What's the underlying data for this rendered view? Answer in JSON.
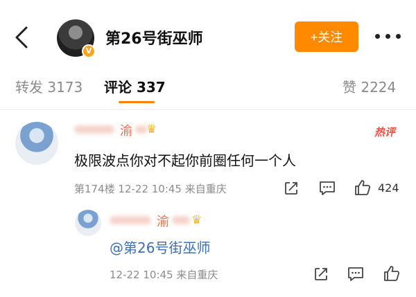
{
  "header": {
    "back_icon": "chevron-left-icon",
    "name": "第26号街巫师",
    "badge_icon": "verified-badge-icon",
    "follow_label": "+关注",
    "more_icon": "more-dots-icon",
    "accent_color": "#ff8a00"
  },
  "tabs": [
    {
      "label": "转发 3173",
      "active": false
    },
    {
      "label": "评论 337",
      "active": true
    },
    {
      "label": "赞 2224",
      "active": false
    }
  ],
  "comment": {
    "name_visible": "渝",
    "hot_tag": "热评",
    "text": "极限波点你对不起你前圈任何一个人",
    "meta": "第174楼  12-22 10:45  来自重庆",
    "like_count": "424"
  },
  "reply": {
    "name_visible": "渝",
    "text": "@第26号街巫师",
    "meta": "12-22 10:45  来自重庆"
  }
}
